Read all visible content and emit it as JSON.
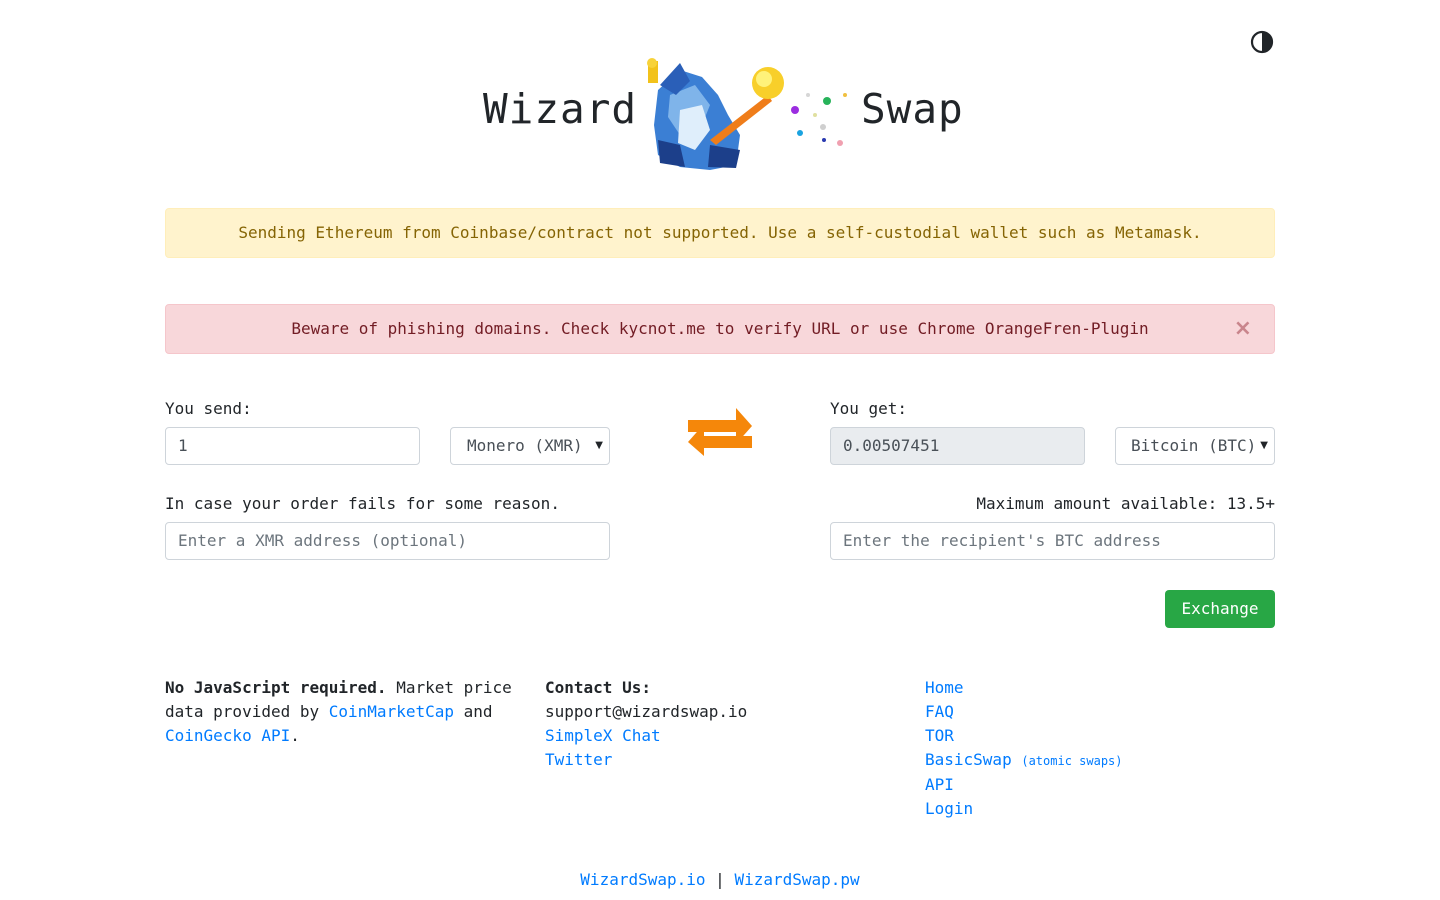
{
  "header": {
    "brand_left": "Wizard",
    "brand_right": "Swap",
    "theme_toggle_icon": "contrast-icon"
  },
  "alerts": {
    "warning_text": "Sending Ethereum from Coinbase/contract not supported. Use a self-custodial wallet such as Metamask.",
    "danger_text": "Beware of phishing domains. Check kycnot.me to verify URL or use Chrome OrangeFren-Plugin",
    "close_glyph": "×"
  },
  "exchange": {
    "send_label": "You send:",
    "send_amount": "1",
    "send_currency": "Monero (XMR)",
    "get_label": "You get:",
    "get_amount": "0.00507451",
    "get_currency": "Bitcoin (BTC)",
    "refund_label": "In case your order fails for some reason.",
    "refund_placeholder": "Enter a XMR address (optional)",
    "max_label": "Maximum amount available: 13.5+",
    "recipient_placeholder": "Enter the recipient's BTC address",
    "exchange_button": "Exchange",
    "swap_icon": "swap-arrows-icon"
  },
  "footer": {
    "about_bold": "No JavaScript required.",
    "about_text_1": " Market price data provided by ",
    "about_link_1": "CoinMarketCap",
    "about_text_2": " and ",
    "about_link_2": "CoinGecko API",
    "about_text_3": ".",
    "contact_heading": "Contact Us:",
    "contact_email": "support@wizardswap.io",
    "contact_links": [
      "SimpleX Chat",
      "Twitter"
    ],
    "nav_links": [
      "Home",
      "FAQ",
      "TOR",
      "BasicSwap",
      "API",
      "Login"
    ],
    "basicswap_note": "(atomic swaps)",
    "domain_1": "WizardSwap.io",
    "domain_sep": "|",
    "domain_2": "WizardSwap.pw"
  },
  "colors": {
    "accent_link": "#007bff",
    "exchange_green": "#28a745",
    "swap_orange": "#f5870a",
    "warning_bg": "#fff3cd",
    "danger_bg": "#f8d7da"
  }
}
